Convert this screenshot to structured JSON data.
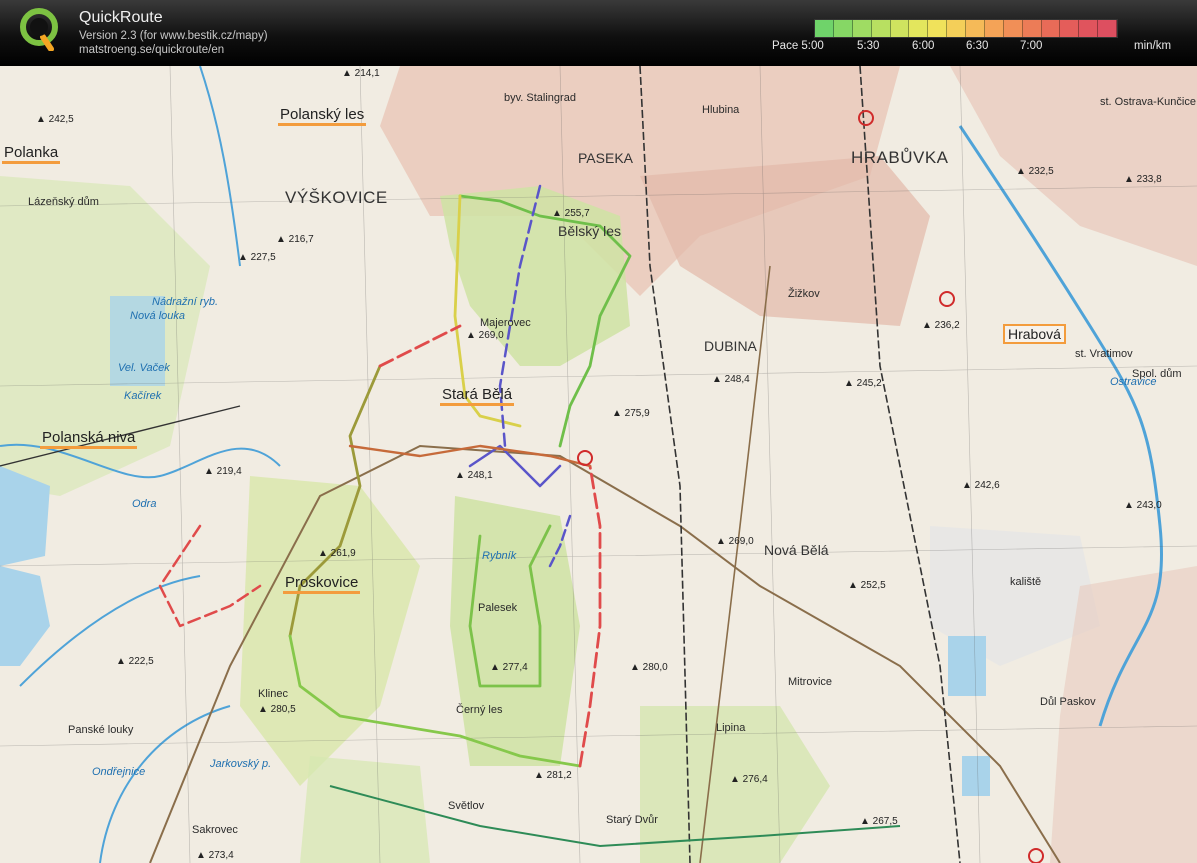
{
  "app": {
    "title": "QuickRoute",
    "version": "Version 2.3  (for www.bestik.cz/mapy)",
    "url": "matstroeng.se/quickroute/en"
  },
  "pace_legend": {
    "labels": [
      "Pace 5:00",
      "5:30",
      "6:00",
      "6:30",
      "7:00"
    ],
    "unit": "min/km",
    "colors": [
      "#6fd36a",
      "#86d765",
      "#9fdc63",
      "#b8e061",
      "#cfe35f",
      "#e3e65d",
      "#f0e25b",
      "#f4cf59",
      "#f5ba58",
      "#f4a357",
      "#f18f57",
      "#ec7c57",
      "#e86b58",
      "#e45d5a",
      "#e0545d",
      "#dd4f60"
    ]
  },
  "map": {
    "places": [
      {
        "name": "place-vyskovice",
        "text": "VÝŠKOVICE",
        "cls": "big"
      },
      {
        "name": "place-hrabuvka",
        "text": "HRABŮVKA",
        "cls": "big"
      },
      {
        "name": "place-paseka",
        "text": "PASEKA",
        "cls": "med"
      },
      {
        "name": "place-dubina",
        "text": "DUBINA",
        "cls": "med"
      },
      {
        "name": "place-stara-bela",
        "text": "Stará Bělá",
        "cls": "hl"
      },
      {
        "name": "place-polanka",
        "text": "Polanka",
        "cls": "hl"
      },
      {
        "name": "place-proskovice",
        "text": "Proskovice",
        "cls": "hl"
      },
      {
        "name": "place-hrabova",
        "text": "Hrabová",
        "cls": "hlbox"
      },
      {
        "name": "place-nova-bela",
        "text": "Nová Bělá",
        "cls": "med"
      },
      {
        "name": "place-belsky-les",
        "text": "Bělský les",
        "cls": "med"
      },
      {
        "name": "place-polansky-les",
        "text": "Polanský les",
        "cls": "hl"
      },
      {
        "name": "place-polanska-niva",
        "text": "Polanská niva",
        "cls": "hl"
      },
      {
        "name": "place-majerovec",
        "text": "Majerovec",
        "cls": ""
      },
      {
        "name": "place-zizkov",
        "text": "Žižkov",
        "cls": ""
      },
      {
        "name": "place-mitrovice",
        "text": "Mitrovice",
        "cls": ""
      },
      {
        "name": "place-lipina",
        "text": "Lipina",
        "cls": ""
      },
      {
        "name": "place-klinec",
        "text": "Klinec",
        "cls": ""
      },
      {
        "name": "place-svetlov",
        "text": "Světlov",
        "cls": ""
      },
      {
        "name": "place-stary-dvur",
        "text": "Starý Dvůr",
        "cls": ""
      },
      {
        "name": "place-sakrovec",
        "text": "Sakrovec",
        "cls": ""
      },
      {
        "name": "place-panske-louky",
        "text": "Panské louky",
        "cls": ""
      },
      {
        "name": "place-palesek",
        "text": "Palesek",
        "cls": ""
      },
      {
        "name": "place-cerny-les",
        "text": "Černý les",
        "cls": ""
      },
      {
        "name": "place-lazensky-dum",
        "text": "Lázeňský dům",
        "cls": ""
      },
      {
        "name": "place-spol-dum",
        "text": "Spol. dům",
        "cls": ""
      },
      {
        "name": "place-nova-louka",
        "text": "Nová louka",
        "cls": "water"
      },
      {
        "name": "place-odra",
        "text": "Odra",
        "cls": "water"
      },
      {
        "name": "place-ostravice",
        "text": "Ostravice",
        "cls": "water"
      },
      {
        "name": "place-st-vratimov",
        "text": "st. Vratimov",
        "cls": ""
      },
      {
        "name": "place-dul-paskov",
        "text": "Důl Paskov",
        "cls": ""
      },
      {
        "name": "place-stalingrad",
        "text": "byv. Stalingrad",
        "cls": ""
      },
      {
        "name": "place-ostrava-kuncice",
        "text": "st. Ostrava-Kunčice",
        "cls": ""
      },
      {
        "name": "place-hlubina",
        "text": "Hlubina",
        "cls": ""
      },
      {
        "name": "place-kaliste",
        "text": "kaliště",
        "cls": ""
      },
      {
        "name": "place-rybnik",
        "text": "Rybník",
        "cls": "water"
      },
      {
        "name": "place-nadrazni-ryb",
        "text": "Nádražní ryb.",
        "cls": "water"
      },
      {
        "name": "place-vel-vacek",
        "text": "Vel. Vaček",
        "cls": "water"
      },
      {
        "name": "place-kacirek",
        "text": "Kačírek",
        "cls": "water"
      },
      {
        "name": "place-jarkovsky",
        "text": "Jarkovský p.",
        "cls": "water"
      },
      {
        "name": "place-ondrejnice",
        "text": "Ondřejnice",
        "cls": "water"
      }
    ],
    "heights": [
      "242,5",
      "214,1",
      "216,7",
      "227,5",
      "269,0",
      "261,9",
      "222,5",
      "280,5",
      "273,4",
      "281,2",
      "277,4",
      "280,0",
      "276,4",
      "267,5",
      "255,7",
      "252,5",
      "269,0",
      "236,2",
      "245,2",
      "242,6",
      "243,0",
      "233,8",
      "232,5",
      "248,4",
      "275,9",
      "219,4",
      "248,1"
    ]
  }
}
